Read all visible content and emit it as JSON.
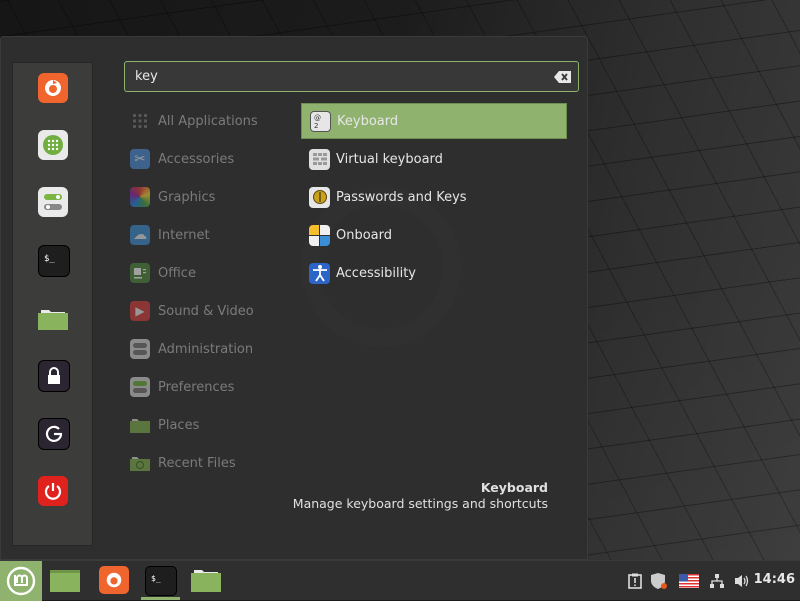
{
  "search": {
    "value": "key",
    "placeholder": ""
  },
  "favorites": [
    {
      "name": "Firefox",
      "icon": "firefox-icon"
    },
    {
      "name": "Software Manager",
      "icon": "software-manager-icon"
    },
    {
      "name": "System Settings",
      "icon": "settings-toggle-icon"
    },
    {
      "name": "Terminal",
      "icon": "terminal-icon"
    },
    {
      "name": "Files",
      "icon": "folder-icon"
    },
    {
      "name": "Lock Screen",
      "icon": "lock-icon"
    },
    {
      "name": "Logout",
      "icon": "logout-icon"
    },
    {
      "name": "Quit",
      "icon": "power-icon"
    }
  ],
  "categories": [
    {
      "label": "All Applications",
      "icon": "grid-icon"
    },
    {
      "label": "Accessories",
      "icon": "scissors-icon"
    },
    {
      "label": "Graphics",
      "icon": "graphics-icon"
    },
    {
      "label": "Internet",
      "icon": "cloud-icon"
    },
    {
      "label": "Office",
      "icon": "office-icon"
    },
    {
      "label": "Sound & Video",
      "icon": "play-icon"
    },
    {
      "label": "Administration",
      "icon": "admin-toggle-icon"
    },
    {
      "label": "Preferences",
      "icon": "preferences-toggle-icon"
    },
    {
      "label": "Places",
      "icon": "folder-icon"
    },
    {
      "label": "Recent Files",
      "icon": "recent-folder-icon"
    }
  ],
  "results": [
    {
      "label": "Keyboard",
      "icon": "keyboard-icon",
      "selected": true
    },
    {
      "label": "Virtual keyboard",
      "icon": "virtual-keyboard-icon"
    },
    {
      "label": "Passwords and Keys",
      "icon": "passwords-keys-icon"
    },
    {
      "label": "Onboard",
      "icon": "onboard-icon"
    },
    {
      "label": "Accessibility",
      "icon": "accessibility-icon"
    }
  ],
  "description": {
    "title": "Keyboard",
    "text": "Manage keyboard settings and shortcuts"
  },
  "panel": {
    "clock": "14:46",
    "colors": {
      "accent": "#8fb36f"
    }
  }
}
